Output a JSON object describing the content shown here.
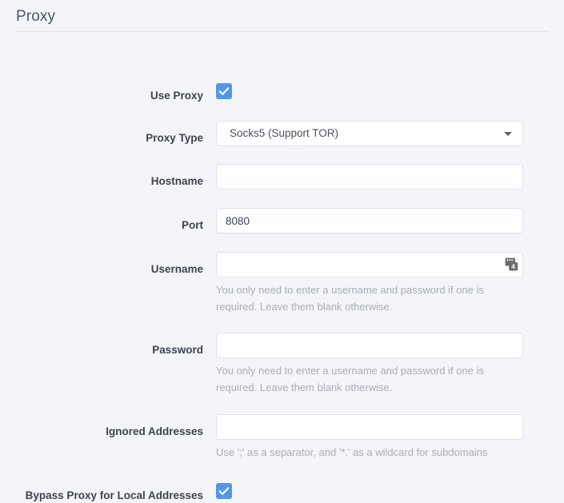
{
  "header": {
    "title": "Proxy"
  },
  "form": {
    "use_proxy": {
      "label": "Use Proxy",
      "checked": true,
      "icon": "checkmark-icon"
    },
    "proxy_type": {
      "label": "Proxy Type",
      "selected": "Socks5 (Support TOR)",
      "icon": "chevron-down-icon"
    },
    "hostname": {
      "label": "Hostname",
      "value": "",
      "placeholder": ""
    },
    "port": {
      "label": "Port",
      "value": "8080",
      "placeholder": ""
    },
    "username": {
      "label": "Username",
      "value": "",
      "placeholder": "",
      "help": "You only need to enter a username and password if one is required. Leave them blank otherwise.",
      "icon": "password-manager-icon",
      "icon_badge": "4"
    },
    "password": {
      "label": "Password",
      "value": "",
      "placeholder": "",
      "help": "You only need to enter a username and password if one is required. Leave them blank otherwise."
    },
    "ignored_addresses": {
      "label": "Ignored Addresses",
      "value": "",
      "placeholder": "",
      "help": "Use ';' as a separator, and '*.' as a wildcard for subdomains"
    },
    "bypass_local": {
      "label": "Bypass Proxy for Local Addresses",
      "checked": true,
      "icon": "checkmark-icon"
    }
  },
  "colors": {
    "background": "#f4f5f9",
    "accent": "#5596e6",
    "text": "#3d4450",
    "help_text": "#a8adb8",
    "border": "#dfe3ea",
    "divider": "#e2e4ea"
  }
}
